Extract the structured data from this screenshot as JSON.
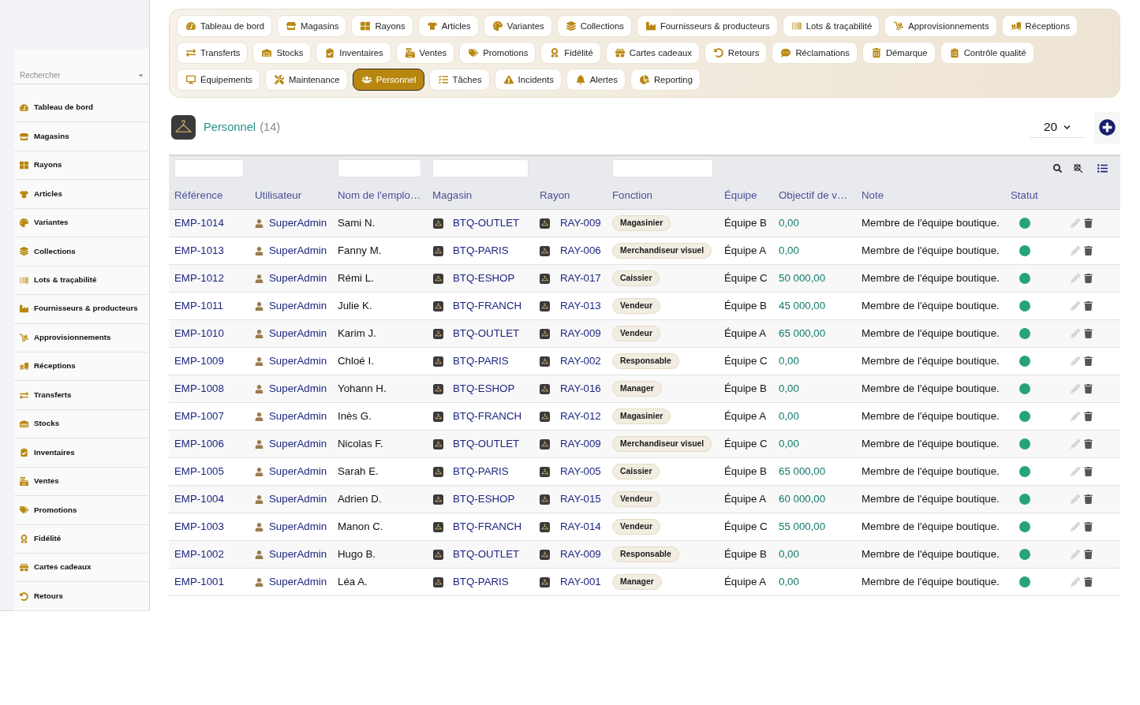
{
  "sidebar": {
    "search": {
      "placeholder": "Rechercher"
    },
    "items": [
      {
        "label": "Tableau de bord",
        "selected": false
      },
      {
        "label": "Magasins",
        "selected": false
      },
      {
        "label": "Rayons",
        "selected": false
      },
      {
        "label": "Articles",
        "selected": false
      },
      {
        "label": "Variantes",
        "selected": false
      },
      {
        "label": "Collections",
        "selected": false
      },
      {
        "label": "Lots & traçabilité",
        "selected": false
      },
      {
        "label": "Fournisseurs & producteurs",
        "selected": false
      },
      {
        "label": "Approvisionnements",
        "selected": false
      },
      {
        "label": "Réceptions",
        "selected": false
      },
      {
        "label": "Transferts",
        "selected": false
      },
      {
        "label": "Stocks",
        "selected": false
      },
      {
        "label": "Inventaires",
        "selected": false
      },
      {
        "label": "Ventes",
        "selected": false
      },
      {
        "label": "Promotions",
        "selected": false
      },
      {
        "label": "Fidélité",
        "selected": false
      },
      {
        "label": "Cartes cadeaux",
        "selected": false
      },
      {
        "label": "Retours",
        "selected": false
      }
    ]
  },
  "nav": {
    "buttons": [
      {
        "label": "Tableau de bord",
        "selected": false
      },
      {
        "label": "Magasins",
        "selected": false
      },
      {
        "label": "Rayons",
        "selected": false
      },
      {
        "label": "Articles",
        "selected": false
      },
      {
        "label": "Variantes",
        "selected": false
      },
      {
        "label": "Collections",
        "selected": false
      },
      {
        "label": "Fournisseurs & producteurs",
        "selected": false
      },
      {
        "label": "Lots & traçabilité",
        "selected": false
      },
      {
        "label": "Approvisionnements",
        "selected": false
      },
      {
        "label": "Réceptions",
        "selected": false
      },
      {
        "label": "Transferts",
        "selected": false
      },
      {
        "label": "Stocks",
        "selected": false
      },
      {
        "label": "Inventaires",
        "selected": false
      },
      {
        "label": "Ventes",
        "selected": false
      },
      {
        "label": "Promotions",
        "selected": false
      },
      {
        "label": "Fidélité",
        "selected": false
      },
      {
        "label": "Cartes cadeaux",
        "selected": false
      },
      {
        "label": "Retours",
        "selected": false
      },
      {
        "label": "Réclamations",
        "selected": false
      },
      {
        "label": "Démarque",
        "selected": false
      },
      {
        "label": "Contrôle qualité",
        "selected": false
      },
      {
        "label": "Équipements",
        "selected": false
      },
      {
        "label": "Maintenance",
        "selected": false
      },
      {
        "label": "Personnel",
        "selected": true
      },
      {
        "label": "Tâches",
        "selected": false
      },
      {
        "label": "Incidents",
        "selected": false
      },
      {
        "label": "Alertes",
        "selected": false
      },
      {
        "label": "Reporting",
        "selected": false
      }
    ]
  },
  "header": {
    "title": "Personnel",
    "count": "(14)",
    "per_page": "20"
  },
  "table": {
    "columns": [
      {
        "label": "Référence",
        "filter": true
      },
      {
        "label": "Utilisateur",
        "filter": false
      },
      {
        "label": "Nom de l'emplo…",
        "filter": true
      },
      {
        "label": "Magasin",
        "filter": true
      },
      {
        "label": "Rayon",
        "filter": false
      },
      {
        "label": "Fonction",
        "filter": true
      },
      {
        "label": "Équipe",
        "filter": false
      },
      {
        "label": "Objectif de v…",
        "filter": false
      },
      {
        "label": "Note",
        "filter": false
      },
      {
        "label": "Statut",
        "filter": false
      }
    ],
    "rows": [
      {
        "reference": "EMP-1014",
        "user": "SuperAdmin",
        "name": "Sami N.",
        "store": "BTQ-OUTLET",
        "aisle": "RAY-009",
        "role": "Magasinier",
        "team": "Équipe B",
        "target": "0,00",
        "note": "Membre de l'équipe boutique.",
        "active": true
      },
      {
        "reference": "EMP-1013",
        "user": "SuperAdmin",
        "name": "Fanny M.",
        "store": "BTQ-PARIS",
        "aisle": "RAY-006",
        "role": "Merchandiseur visuel",
        "team": "Équipe A",
        "target": "0,00",
        "note": "Membre de l'équipe boutique.",
        "active": true
      },
      {
        "reference": "EMP-1012",
        "user": "SuperAdmin",
        "name": "Rémi L.",
        "store": "BTQ-ESHOP",
        "aisle": "RAY-017",
        "role": "Caissier",
        "team": "Équipe C",
        "target": "50 000,00",
        "note": "Membre de l'équipe boutique.",
        "active": true
      },
      {
        "reference": "EMP-1011",
        "user": "SuperAdmin",
        "name": "Julie K.",
        "store": "BTQ-FRANCH",
        "aisle": "RAY-013",
        "role": "Vendeur",
        "team": "Équipe B",
        "target": "45 000,00",
        "note": "Membre de l'équipe boutique.",
        "active": true
      },
      {
        "reference": "EMP-1010",
        "user": "SuperAdmin",
        "name": "Karim J.",
        "store": "BTQ-OUTLET",
        "aisle": "RAY-009",
        "role": "Vendeur",
        "team": "Équipe A",
        "target": "65 000,00",
        "note": "Membre de l'équipe boutique.",
        "active": true
      },
      {
        "reference": "EMP-1009",
        "user": "SuperAdmin",
        "name": "Chloé I.",
        "store": "BTQ-PARIS",
        "aisle": "RAY-002",
        "role": "Responsable",
        "team": "Équipe C",
        "target": "0,00",
        "note": "Membre de l'équipe boutique.",
        "active": true
      },
      {
        "reference": "EMP-1008",
        "user": "SuperAdmin",
        "name": "Yohann H.",
        "store": "BTQ-ESHOP",
        "aisle": "RAY-016",
        "role": "Manager",
        "team": "Équipe B",
        "target": "0,00",
        "note": "Membre de l'équipe boutique.",
        "active": true
      },
      {
        "reference": "EMP-1007",
        "user": "SuperAdmin",
        "name": "Inès G.",
        "store": "BTQ-FRANCH",
        "aisle": "RAY-012",
        "role": "Magasinier",
        "team": "Équipe A",
        "target": "0,00",
        "note": "Membre de l'équipe boutique.",
        "active": true
      },
      {
        "reference": "EMP-1006",
        "user": "SuperAdmin",
        "name": "Nicolas F.",
        "store": "BTQ-OUTLET",
        "aisle": "RAY-009",
        "role": "Merchandiseur visuel",
        "team": "Équipe C",
        "target": "0,00",
        "note": "Membre de l'équipe boutique.",
        "active": true
      },
      {
        "reference": "EMP-1005",
        "user": "SuperAdmin",
        "name": "Sarah E.",
        "store": "BTQ-PARIS",
        "aisle": "RAY-005",
        "role": "Caissier",
        "team": "Équipe B",
        "target": "65 000,00",
        "note": "Membre de l'équipe boutique.",
        "active": true
      },
      {
        "reference": "EMP-1004",
        "user": "SuperAdmin",
        "name": "Adrien D.",
        "store": "BTQ-ESHOP",
        "aisle": "RAY-015",
        "role": "Vendeur",
        "team": "Équipe A",
        "target": "60 000,00",
        "note": "Membre de l'équipe boutique.",
        "active": true
      },
      {
        "reference": "EMP-1003",
        "user": "SuperAdmin",
        "name": "Manon C.",
        "store": "BTQ-FRANCH",
        "aisle": "RAY-014",
        "role": "Vendeur",
        "team": "Équipe C",
        "target": "55 000,00",
        "note": "Membre de l'équipe boutique.",
        "active": true
      },
      {
        "reference": "EMP-1002",
        "user": "SuperAdmin",
        "name": "Hugo B.",
        "store": "BTQ-OUTLET",
        "aisle": "RAY-009",
        "role": "Responsable",
        "team": "Équipe B",
        "target": "0,00",
        "note": "Membre de l'équipe boutique.",
        "active": true
      },
      {
        "reference": "EMP-1001",
        "user": "SuperAdmin",
        "name": "Léa A.",
        "store": "BTQ-PARIS",
        "aisle": "RAY-001",
        "role": "Manager",
        "team": "Équipe A",
        "target": "0,00",
        "note": "Membre de l'équipe boutique.",
        "active": true
      }
    ]
  }
}
